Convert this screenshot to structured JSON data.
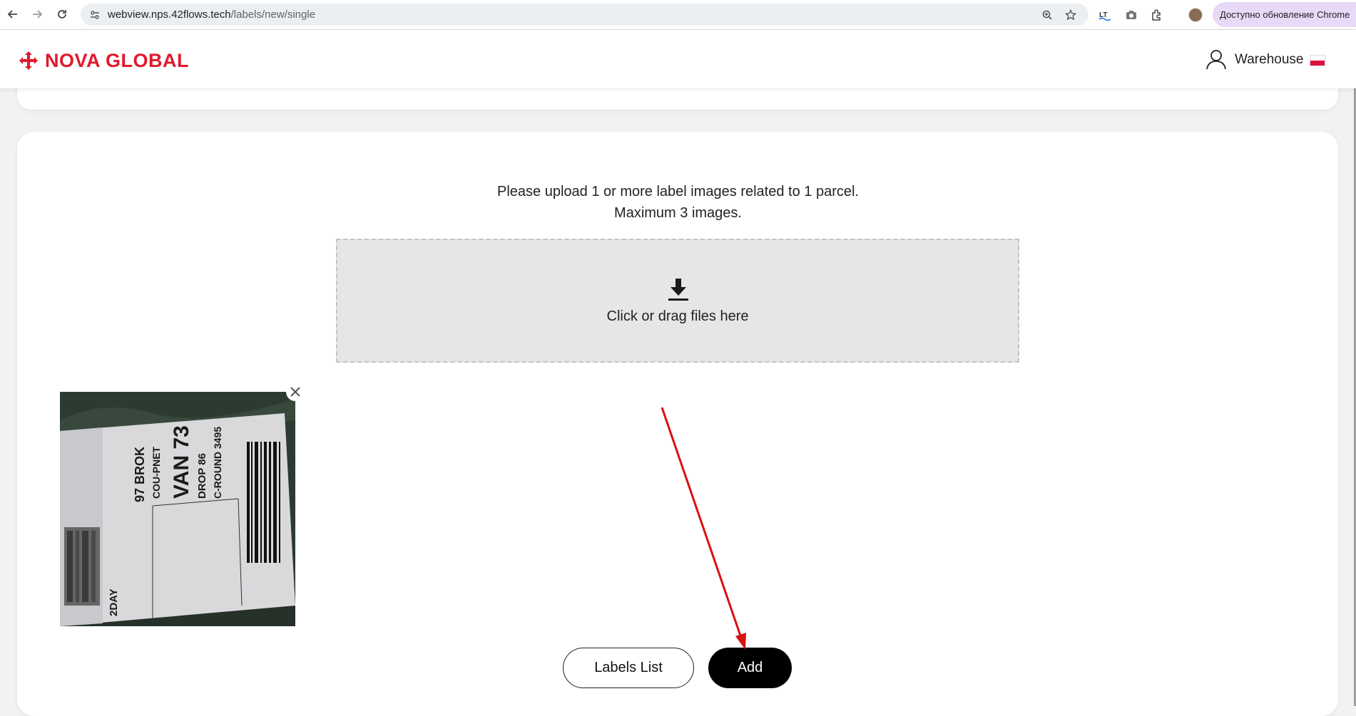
{
  "browser": {
    "url_host": "webview.nps.42flows.tech",
    "url_path": "/labels/new/single",
    "update_label": "Доступно обновление Chrome"
  },
  "header": {
    "logo_text": "NOVA GLOBAL",
    "user_label": "Warehouse",
    "flag": "poland-flag"
  },
  "upload": {
    "instruction_line1": "Please upload 1 or more label images related to 1 parcel.",
    "instruction_line2": "Maximum 3 images.",
    "dropzone_label": "Click or drag files here",
    "dropzone_icon": "download-icon"
  },
  "thumbnail": {
    "label_lines": [
      "97 BROK",
      "COU-PNET",
      "VAN 73",
      "DROP 86",
      "C-ROUND 3495",
      "2DAY"
    ],
    "remove_icon": "close-icon"
  },
  "actions": {
    "labels_list": "Labels List",
    "add": "Add"
  },
  "colors": {
    "brand": "#e01a2d",
    "annotation": "#d91111",
    "primary_button": "#000000"
  }
}
